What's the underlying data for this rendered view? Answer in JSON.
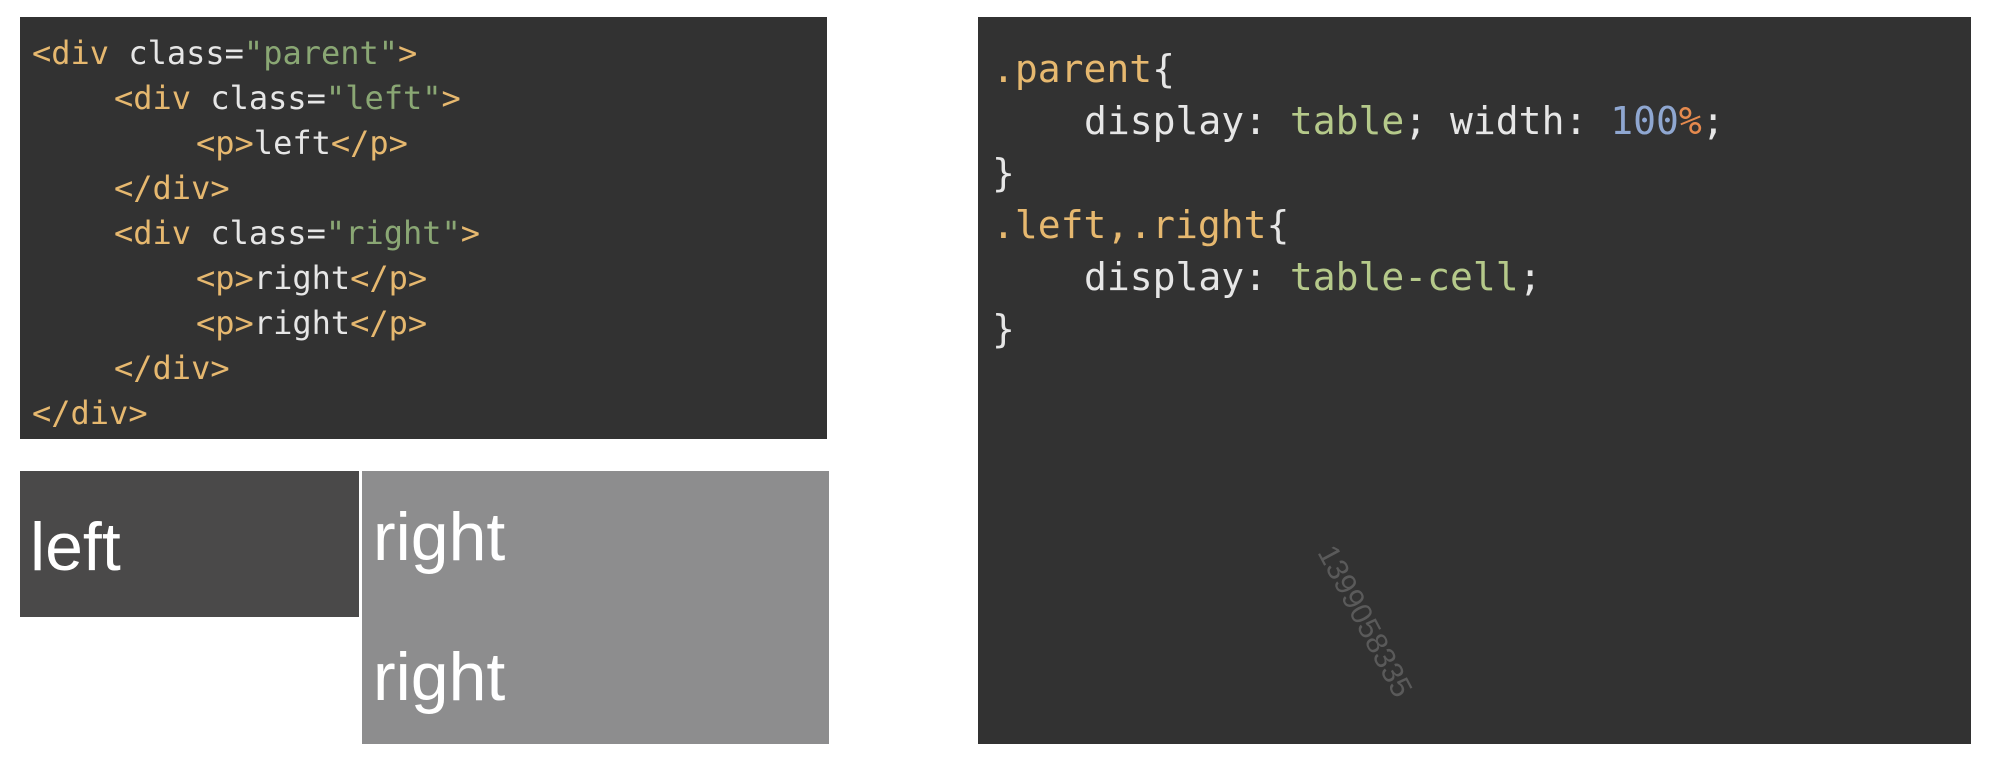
{
  "html_code": {
    "line1": {
      "open": "<div ",
      "attr": "class=",
      "value": "\"parent\"",
      "close": ">"
    },
    "line2": {
      "open": "<div ",
      "attr": "class=",
      "value": "\"left\"",
      "close": ">"
    },
    "line3": {
      "open": "<p>",
      "text": "left",
      "close": "</p>"
    },
    "line4": {
      "close": "</div>"
    },
    "line5": {
      "open": "<div ",
      "attr": "class=",
      "value": "\"right\"",
      "close": ">"
    },
    "line6": {
      "open": "<p>",
      "text": "right",
      "close": "</p>"
    },
    "line7": {
      "open": "<p>",
      "text": "right",
      "close": "</p>"
    },
    "line8": {
      "close": "</div>"
    },
    "line9": {
      "close": "</div>"
    }
  },
  "demo": {
    "left_text": "left",
    "right_text_1": "right",
    "right_text_2": "right",
    "left_color": "#4a4949",
    "right_color": "#8d8d8e"
  },
  "css_code": {
    "rule1_selector": ".parent",
    "rule1_open": "{",
    "rule1_prop1": "display: ",
    "rule1_val1": "table",
    "rule1_sep": "; width: ",
    "rule1_num": "100",
    "rule1_unit": "%",
    "rule1_end": ";",
    "rule1_close": "}",
    "rule2_selector": ".left,.right",
    "rule2_open": "{",
    "rule2_prop1": "display: ",
    "rule2_val1": "table-cell",
    "rule2_end": ";",
    "rule2_close": "}"
  },
  "watermark": "1399058335",
  "colors": {
    "panel_bg": "#323232",
    "tag": "#e6b86f",
    "string": "#8aa774",
    "css_value": "#b5c98a",
    "number": "#8fa7d1",
    "unit": "#e68a4e"
  }
}
